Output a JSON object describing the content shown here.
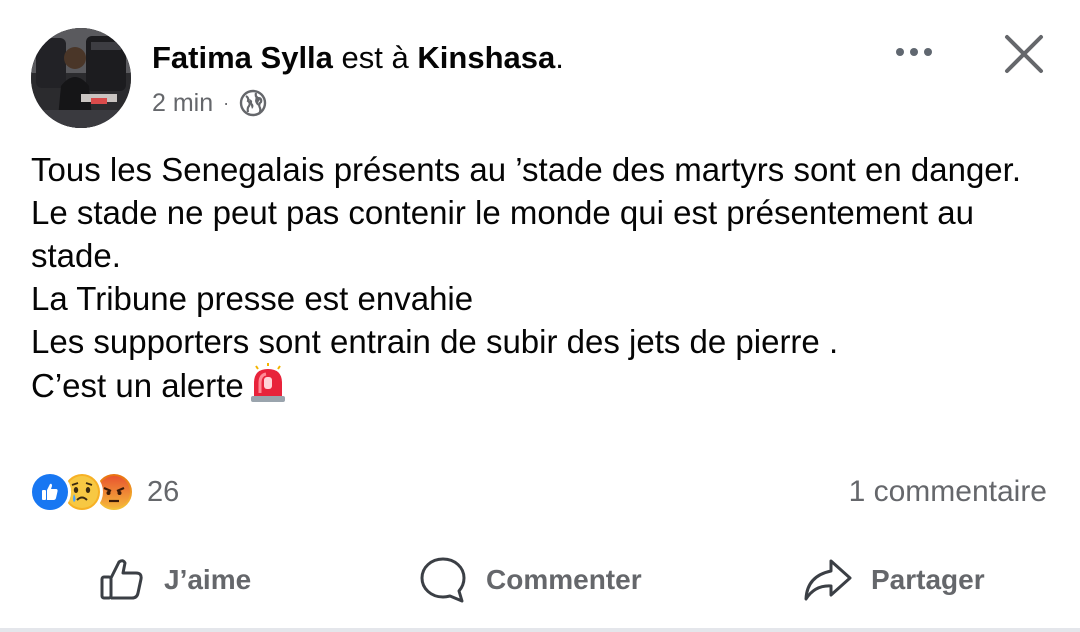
{
  "post": {
    "author": "Fatima Sylla",
    "location_prefix": "est à",
    "location": "Kinshasa",
    "location_suffix": ".",
    "time": "2 min",
    "meta_separator": "·",
    "audience_icon": "globe-icon",
    "text_lines": [
      "Tous les Senegalais présents au ’stade des martyrs sont en danger.",
      "Le stade ne peut pas contenir le monde qui est présentement au stade.",
      "La Tribune presse est envahie",
      "Les supporters sont entrain de subir des jets de pierre .",
      "C’est un alerte"
    ],
    "alert_emoji": "rotating-light-icon"
  },
  "reactions": {
    "types": [
      "like-icon",
      "sad-icon",
      "angry-icon"
    ],
    "count": "26"
  },
  "comments": {
    "label": "1 commentaire"
  },
  "actions": {
    "like_label": "J’aime",
    "comment_label": "Commenter",
    "share_label": "Partager"
  },
  "colors": {
    "text": "#050505",
    "secondary": "#65676b",
    "like_blue": "#1877f2",
    "divider": "#e4e6eb"
  }
}
